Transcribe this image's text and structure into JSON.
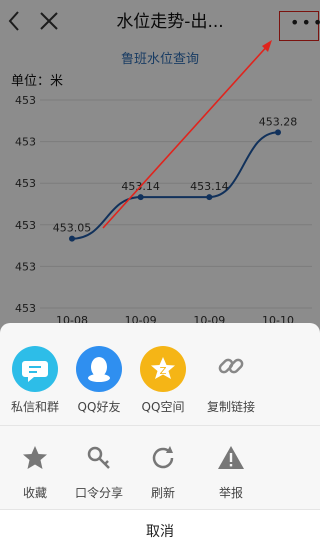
{
  "navbar": {
    "title": "水位走势-出..."
  },
  "page": {
    "title": "鲁班水位查询",
    "unit_label": "单位：米"
  },
  "chart_data": {
    "type": "line",
    "title": "",
    "categories": [
      "10-08",
      "10-09",
      "10-09",
      "10-10"
    ],
    "y_tick_labels": [
      "453",
      "453",
      "453",
      "453",
      "453",
      "453"
    ],
    "series": [
      {
        "values": [
          453.05,
          453.14,
          453.14,
          453.28
        ]
      }
    ],
    "data_labels": [
      "453.05",
      "453.14",
      "453.14",
      "453.28"
    ],
    "ylim": [
      452.9,
      453.35
    ],
    "line_color": "#1f5aa6"
  },
  "share_sheet": {
    "row1": [
      {
        "label": "私信和群",
        "icon": "chat-bubble-icon",
        "color": "#2dbde8"
      },
      {
        "label": "QQ好友",
        "icon": "qq-penguin-icon",
        "color": "#2f8ff0"
      },
      {
        "label": "QQ空间",
        "icon": "qzone-star-icon",
        "color": "#f5b516"
      },
      {
        "label": "复制链接",
        "icon": "link-icon",
        "color": "#888888"
      }
    ],
    "row2": [
      {
        "label": "收藏",
        "icon": "star-icon"
      },
      {
        "label": "口令分享",
        "icon": "key-icon"
      },
      {
        "label": "刷新",
        "icon": "refresh-icon"
      },
      {
        "label": "举报",
        "icon": "warning-icon"
      }
    ],
    "cancel_label": "取消"
  }
}
